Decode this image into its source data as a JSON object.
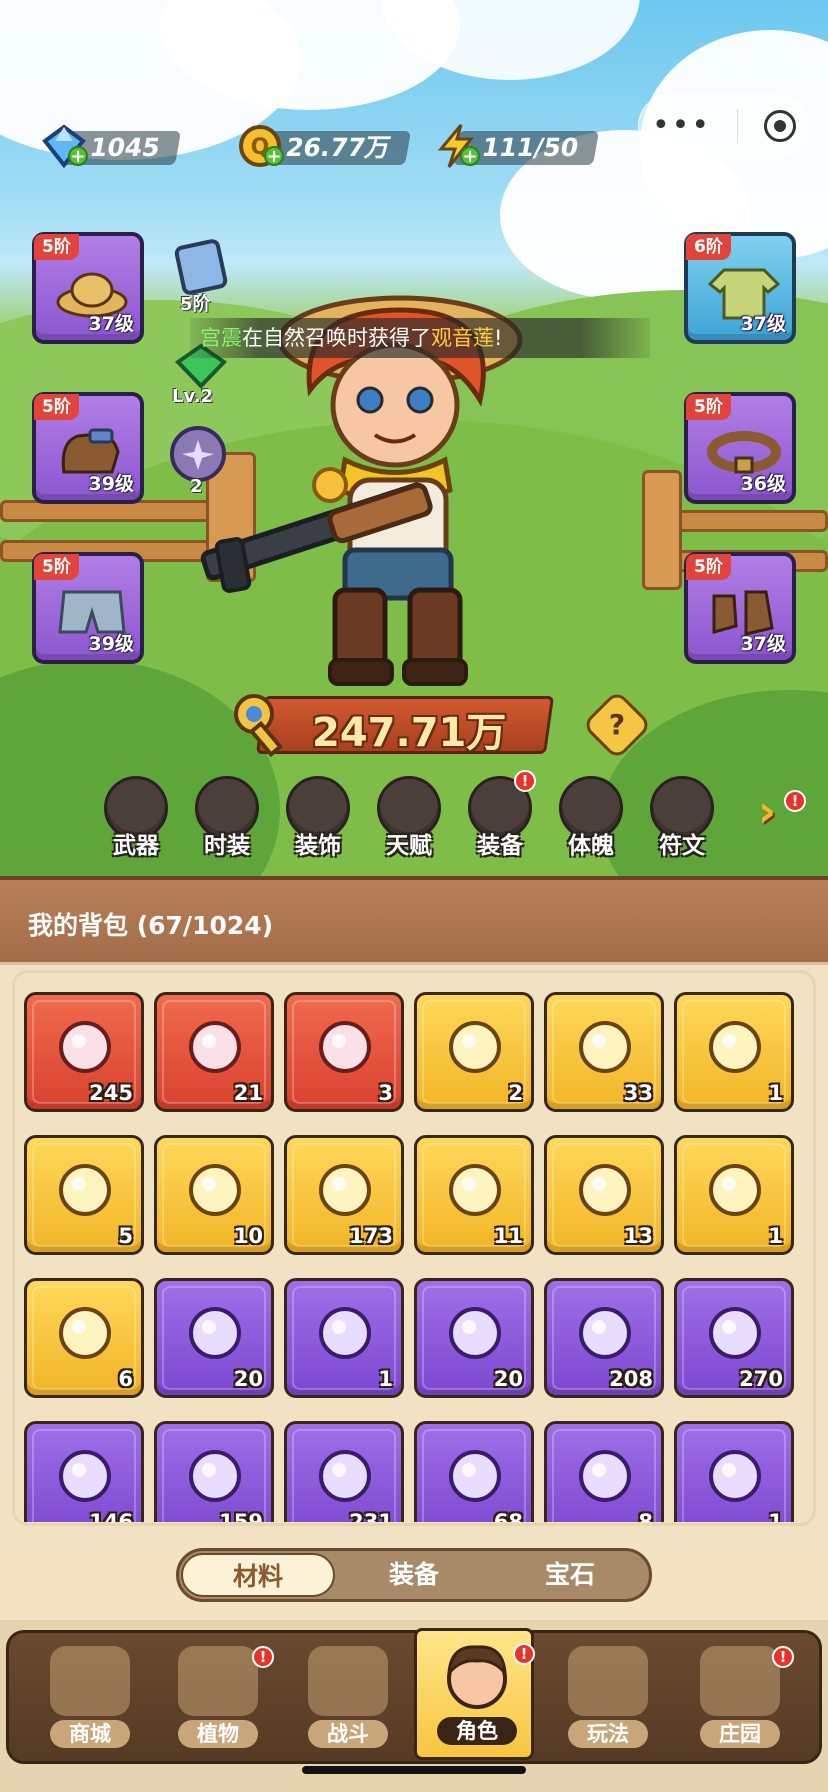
{
  "currency": {
    "gems": "1045",
    "gold": "26.77万",
    "energy": "111/50"
  },
  "slots_left": [
    {
      "tier": "5阶",
      "level": "37级",
      "item": "straw-hat"
    },
    {
      "tier": "5阶",
      "level": "39级",
      "item": "gloves"
    },
    {
      "tier": "5阶",
      "level": "39级",
      "item": "shorts"
    }
  ],
  "slots_right": [
    {
      "tier": "6阶",
      "level": "37级",
      "item": "shirt"
    },
    {
      "tier": "5阶",
      "level": "36级",
      "item": "belt"
    },
    {
      "tier": "5阶",
      "level": "37级",
      "item": "boots"
    }
  ],
  "side_badges": {
    "card_tier": "5阶",
    "gem_level": "Lv.2",
    "orb_count": "2"
  },
  "announcement": {
    "player": "宫震",
    "middle": "在自然召唤时获得了",
    "item": "观音莲",
    "end": "!"
  },
  "power": "247.71万",
  "functions": [
    {
      "label": "武器",
      "badge": false
    },
    {
      "label": "时装",
      "badge": false
    },
    {
      "label": "装饰",
      "badge": false
    },
    {
      "label": "天赋",
      "badge": false
    },
    {
      "label": "装备",
      "badge": true
    },
    {
      "label": "体魄",
      "badge": false
    },
    {
      "label": "符文",
      "badge": false
    }
  ],
  "bag": {
    "title": "我的背包 (67/1024)",
    "items": [
      {
        "color": "red",
        "count": "245",
        "icon": "crystal-star-icon"
      },
      {
        "color": "red",
        "count": "21",
        "icon": "red-potion-icon"
      },
      {
        "color": "red",
        "count": "3",
        "icon": "green-capsule-icon"
      },
      {
        "color": "gold",
        "count": "2",
        "icon": "ruby-key-icon"
      },
      {
        "color": "gold",
        "count": "33",
        "icon": "gold-key-icon"
      },
      {
        "color": "gold",
        "count": "1",
        "icon": "emerald-key-icon"
      },
      {
        "color": "gold",
        "count": "5",
        "icon": "yellow-flower-icon"
      },
      {
        "color": "gold",
        "count": "10",
        "icon": "rune-stone-icon"
      },
      {
        "color": "gold",
        "count": "173",
        "icon": "orange-potion-icon"
      },
      {
        "color": "gold",
        "count": "11",
        "icon": "gold-pile-icon"
      },
      {
        "color": "gold",
        "count": "13",
        "icon": "spell-book-icon"
      },
      {
        "color": "gold",
        "count": "1",
        "icon": "copper-ore-icon"
      },
      {
        "color": "gold",
        "count": "6",
        "icon": "glowing-flower-icon"
      },
      {
        "color": "purple",
        "count": "20",
        "icon": "purple-bottle-icon"
      },
      {
        "color": "purple",
        "count": "1",
        "icon": "silver-key-icon"
      },
      {
        "color": "purple",
        "count": "20",
        "icon": "teal-leaf-icon"
      },
      {
        "color": "purple",
        "count": "208",
        "icon": "green-scroll-icon"
      },
      {
        "color": "purple",
        "count": "270",
        "icon": "red-scroll-icon"
      },
      {
        "color": "purple",
        "count": "146",
        "icon": "blue-scroll-icon"
      },
      {
        "color": "purple",
        "count": "159",
        "icon": "fire-scroll-icon"
      },
      {
        "color": "purple",
        "count": "231",
        "icon": "lightning-scroll-icon"
      },
      {
        "color": "purple",
        "count": "68",
        "icon": "violet-potion-icon"
      },
      {
        "color": "purple",
        "count": "8",
        "icon": "blue-bud-icon"
      },
      {
        "color": "purple",
        "count": "1",
        "icon": "purple-bulb-icon"
      }
    ]
  },
  "tabs": [
    {
      "label": "材料",
      "active": true
    },
    {
      "label": "装备",
      "active": false
    },
    {
      "label": "宝石",
      "active": false
    }
  ],
  "nav": [
    {
      "label": "商城",
      "badge": false,
      "active": false
    },
    {
      "label": "植物",
      "badge": true,
      "active": false
    },
    {
      "label": "战斗",
      "badge": false,
      "active": false
    },
    {
      "label": "角色",
      "badge": true,
      "active": true
    },
    {
      "label": "玩法",
      "badge": false,
      "active": false
    },
    {
      "label": "庄园",
      "badge": true,
      "active": false
    }
  ]
}
